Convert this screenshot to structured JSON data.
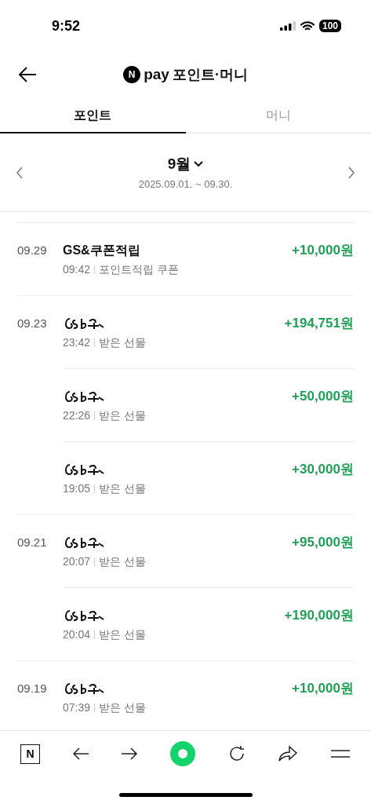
{
  "status_bar": {
    "time": "9:52",
    "battery": "100"
  },
  "header": {
    "logo_letter": "N",
    "logo_word": "pay",
    "title": "포인트·머니"
  },
  "tabs": [
    {
      "label": "포인트",
      "selected": true
    },
    {
      "label": "머니",
      "selected": false
    }
  ],
  "period": {
    "month": "9월",
    "range": "2025.09.01. ~ 09.30."
  },
  "groups": [
    {
      "date": "09.29",
      "items": [
        {
          "name": {
            "kind": "text",
            "text": "GS&쿠폰적립"
          },
          "time": "09:42",
          "type": "포인트적립 쿠폰",
          "amount": "+10,000원"
        }
      ]
    },
    {
      "date": "09.23",
      "items": [
        {
          "name": {
            "kind": "redacted"
          },
          "time": "23:42",
          "type": "받은 선물",
          "amount": "+194,751원"
        },
        {
          "name": {
            "kind": "redacted"
          },
          "time": "22:26",
          "type": "받은 선물",
          "amount": "+50,000원"
        },
        {
          "name": {
            "kind": "redacted"
          },
          "time": "19:05",
          "type": "받은 선물",
          "amount": "+30,000원"
        }
      ]
    },
    {
      "date": "09.21",
      "items": [
        {
          "name": {
            "kind": "redacted"
          },
          "time": "20:07",
          "type": "받은 선물",
          "amount": "+95,000원"
        },
        {
          "name": {
            "kind": "redacted"
          },
          "time": "20:04",
          "type": "받은 선물",
          "amount": "+190,000원"
        }
      ]
    },
    {
      "date": "09.19",
      "items": [
        {
          "name": {
            "kind": "redacted"
          },
          "time": "07:39",
          "type": "받은 선물",
          "amount": "+10,000원"
        }
      ]
    }
  ],
  "toolbar": {
    "home_letter": "N"
  }
}
